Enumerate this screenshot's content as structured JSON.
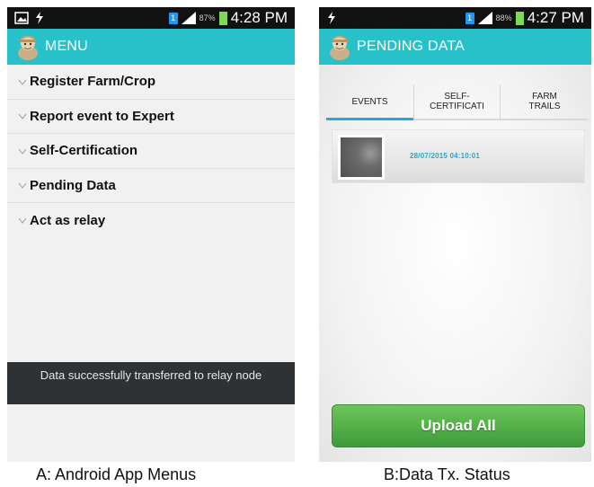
{
  "phone_a": {
    "status": {
      "battery_pct": "87%",
      "time": "4:28 PM",
      "sim": "1"
    },
    "appbar": {
      "title": "MENU"
    },
    "menu": [
      {
        "label": "Register Farm/Crop"
      },
      {
        "label": "Report event to Expert"
      },
      {
        "label": "Self-Certification"
      },
      {
        "label": "Pending Data"
      },
      {
        "label": "Act as relay"
      }
    ],
    "toast": "Data successfully transferred to relay node"
  },
  "phone_b": {
    "status": {
      "battery_pct": "88%",
      "time": "4:27 PM",
      "sim": "1"
    },
    "appbar": {
      "title": "PENDING DATA"
    },
    "tabs": [
      {
        "label": "EVENTS",
        "active": true
      },
      {
        "label": "SELF-\nCERTIFICATI",
        "active": false
      },
      {
        "label": "FARM\nTRAILS",
        "active": false
      }
    ],
    "event": {
      "timestamp": "28/07/2015 04:10:01"
    },
    "upload_button": "Upload All"
  },
  "captions": {
    "a": "A: Android App Menus",
    "b": "B:Data Tx. Status"
  },
  "colors": {
    "appbar": "#28c0c9",
    "upload_button": "#4fae43",
    "tab_indicator": "#28a7d9",
    "timestamp": "#2aa7c8",
    "battery": "#7ed957"
  }
}
